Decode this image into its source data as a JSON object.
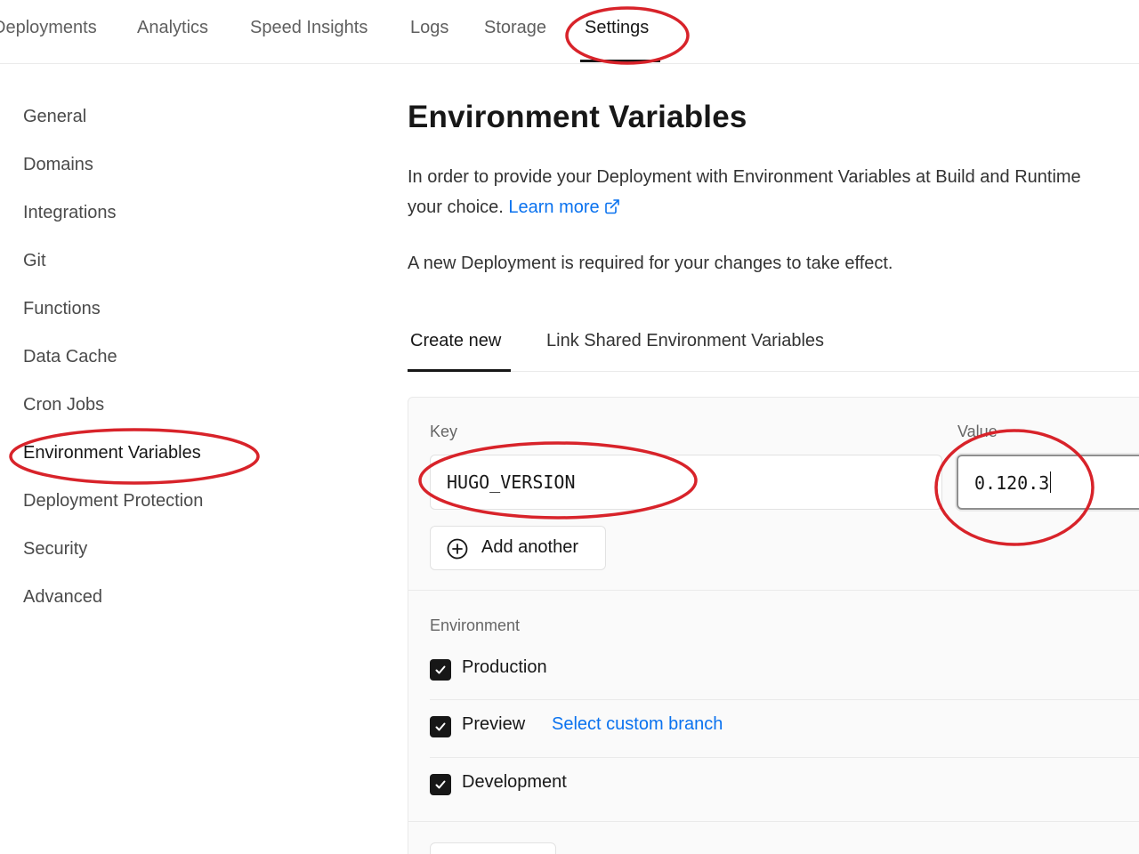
{
  "top_nav": {
    "tabs": [
      "Deployments",
      "Analytics",
      "Speed Insights",
      "Logs",
      "Storage",
      "Settings"
    ],
    "active": "Settings"
  },
  "sidebar": {
    "items": [
      "General",
      "Domains",
      "Integrations",
      "Git",
      "Functions",
      "Data Cache",
      "Cron Jobs",
      "Environment Variables",
      "Deployment Protection",
      "Security",
      "Advanced"
    ],
    "active": "Environment Variables"
  },
  "main": {
    "title": "Environment Variables",
    "description_line1": "In order to provide your Deployment with Environment Variables at Build and Runtime",
    "description_line2": "your choice.",
    "learn_more": "Learn more",
    "notice": "A new Deployment is required for your changes to take effect.",
    "tabs": [
      "Create new",
      "Link Shared Environment Variables"
    ],
    "active_tab": "Create new"
  },
  "form": {
    "key_label": "Key",
    "value_label": "Value",
    "key_value": "HUGO_VERSION",
    "value_value": "0.120.3",
    "add_another": "Add another",
    "environment_label": "Environment",
    "environments": [
      {
        "label": "Production",
        "checked": true
      },
      {
        "label": "Preview",
        "checked": true,
        "link": "Select custom branch"
      },
      {
        "label": "Development",
        "checked": true
      }
    ]
  },
  "colors": {
    "accent_link": "#0a72ef",
    "annotation": "#d8232a",
    "checkbox": "#171717"
  }
}
